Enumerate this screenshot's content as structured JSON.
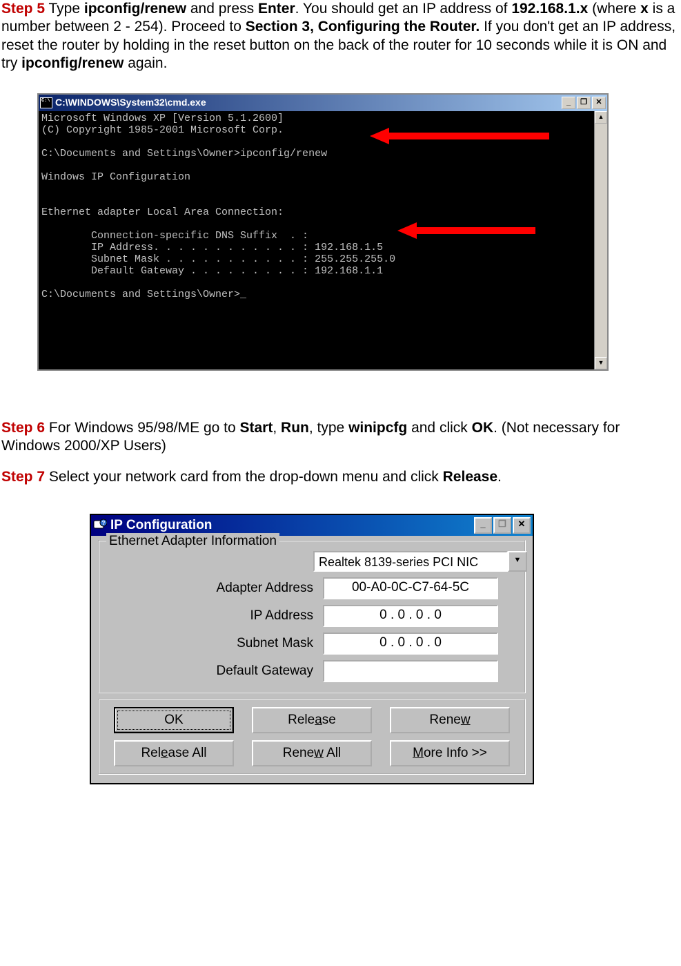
{
  "step5": {
    "label": "Step 5",
    "t1": " Type ",
    "b1": "ipconfig/renew",
    "t2": " and press ",
    "b2": "Enter",
    "t3": ". You should get an IP address of ",
    "b3": "192.168.1.x",
    "t4": " (where ",
    "b4": "x",
    "t5": " is a number between 2 - 254). Proceed to ",
    "b5": "Section 3, Configuring the Router.",
    "t6": " If you don't get an IP address, reset the router by holding in the reset button on the back of the router for 10 seconds while it is ON and try ",
    "b6": "ipconfig/renew",
    "t7": " again."
  },
  "cmd": {
    "title": "C:\\WINDOWS\\System32\\cmd.exe",
    "lines": "Microsoft Windows XP [Version 5.1.2600]\n(C) Copyright 1985-2001 Microsoft Corp.\n\nC:\\Documents and Settings\\Owner>ipconfig/renew\n\nWindows IP Configuration\n\n\nEthernet adapter Local Area Connection:\n\n        Connection-specific DNS Suffix  . :\n        IP Address. . . . . . . . . . . . : 192.168.1.5\n        Subnet Mask . . . . . . . . . . . : 255.255.255.0\n        Default Gateway . . . . . . . . . : 192.168.1.1\n\nC:\\Documents and Settings\\Owner>_",
    "min": "_",
    "max": "❐",
    "close": "✕",
    "up": "▲",
    "down": "▼"
  },
  "step6": {
    "label": "Step 6",
    "t1": " For Windows 95/98/ME go to ",
    "b1": "Start",
    "t2": ", ",
    "b2": "Run",
    "t3": ", type ",
    "b3": "winipcfg",
    "t4": " and click ",
    "b4": "OK",
    "t5": ".  (Not necessary for Windows 2000/XP Users)"
  },
  "step7": {
    "label": "Step 7",
    "t1": " Select your network card from the drop-down menu and click ",
    "b1": "Release",
    "t2": "."
  },
  "ipc": {
    "title": "IP Configuration",
    "group": "Ethernet  Adapter Information",
    "nic": "Realtek 8139-series PCI NIC",
    "drop": "▼",
    "rows": {
      "adapter_lbl": "Adapter Address",
      "adapter_val": "00-A0-0C-C7-64-5C",
      "ip_lbl": "IP Address",
      "ip_val": "0 . 0 . 0 . 0",
      "mask_lbl": "Subnet Mask",
      "mask_val": "0 . 0 . 0 . 0",
      "gw_lbl": "Default Gateway",
      "gw_val": ""
    },
    "buttons": {
      "ok": "OK",
      "release_pre": "Rele",
      "release_u": "a",
      "release_post": "se",
      "renew_pre": "Rene",
      "renew_u": "w",
      "renew_post": "",
      "releaseall_pre": "Rel",
      "releaseall_u": "e",
      "releaseall_post": "ase All",
      "renewall_pre": "Rene",
      "renewall_u": "w",
      "renewall_post": " All",
      "more_u": "M",
      "more_post": "ore Info >>"
    },
    "min": "_",
    "max": "❐",
    "close": "✕"
  }
}
